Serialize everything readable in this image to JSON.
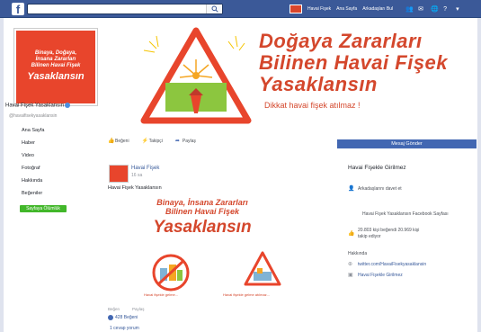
{
  "topbar": {
    "logo": "f",
    "search_placeholder": "",
    "user_name": "Havai Fişek",
    "home_link": "Ana Sayfa",
    "find_friends": "Arkadaşları Bul",
    "icons": [
      "friends-icon",
      "messages-icon",
      "notifications-icon",
      "globe-icon",
      "menu-icon"
    ]
  },
  "cover": {
    "profile_lines": [
      "Binaya, Doğaya,",
      "İnsana Zararları",
      "Bilinen Havai Fişek"
    ],
    "profile_big": "Yasaklansın",
    "title_lines": [
      "Doğaya Zararları",
      "Bilinen Havai Fişek",
      "Yasaklansın"
    ],
    "subtitle": "Dikkat havai fişek atılmaz !"
  },
  "left": {
    "page_name": "Havai Fişek Yasaklansın",
    "handle": "@havaifisekyasaklansin",
    "nav": [
      "Ana Sayfa",
      "Haber",
      "Video",
      "Fotoğraf",
      "Hakkında",
      "Beğeniler"
    ],
    "create_button": "Sayfaya Ölümlük"
  },
  "actions": {
    "like": "Beğeni",
    "follow": "Takipçi",
    "share": "Paylaş"
  },
  "post": {
    "author": "Havai Fişek",
    "time": "16 sa",
    "text": "Havai Fişek Yasaklansın",
    "img_line1": "Binaya, İnsana Zararları",
    "img_line2": "Bilinen Havai Fişek",
    "img_big": "Yasaklansın",
    "caption_left": "Havai fişekle gelme...",
    "caption_right": "Havai fişekle gelme atılmaz...",
    "foot_like": "Beğen",
    "foot_share": "Paylaş",
    "likes": "428 Beğeni",
    "comment": "1 cevap yorum"
  },
  "right": {
    "message_button": "Mesaj Gönder",
    "title": "Havai Fişekle Girilmez",
    "invite": "Arkadaşlarını davet et",
    "page_desc": "Havai Fişek Yasaklansın Facebook Sayfası",
    "likes_line1": "20.803 kişi beğendi 20.969 kişi",
    "likes_line2": "takip ediyor",
    "about": "Hakkında",
    "twitter": "twitter.com/HavaiFisekyasaklansin",
    "site": "Havai Fişekle Girilmez"
  }
}
